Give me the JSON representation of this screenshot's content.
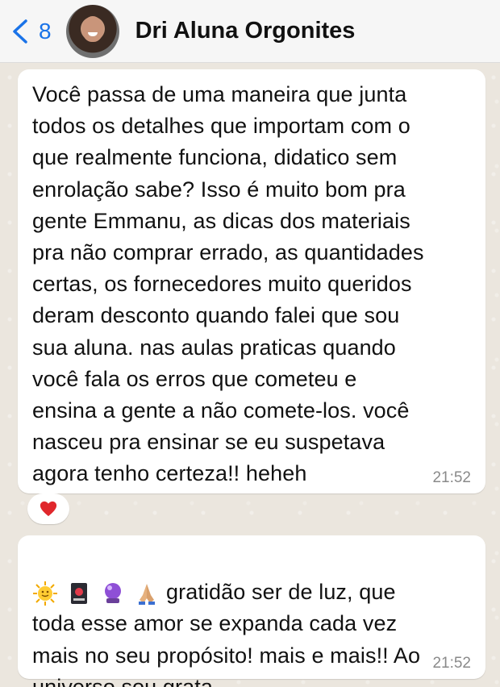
{
  "header": {
    "back_count": "8",
    "contact_name": "Dri Aluna Orgonites"
  },
  "messages": [
    {
      "text": "Você passa de uma maneira que junta\ntodos os detalhes que importam com o\nque realmente funciona, didatico sem\nenrolação sabe? Isso é muito bom pra\ngente Emmanu, as dicas dos materiais\npra não comprar errado, as quantidades\ncertas, os fornecedores muito queridos\nderam desconto quando falei que sou\nsua aluna. nas aulas praticas quando\nvocê fala os erros que cometeu e\nensina a gente a não comete-los. você\nnasceu pra ensinar se eu suspetava\nagora tenho certeza!! heheh",
      "time": "21:52",
      "reaction": "heart"
    },
    {
      "emojis": [
        "sun-face-icon",
        "flower-playing-card-icon",
        "crystal-ball-icon",
        "folded-hands-icon"
      ],
      "text": "gratidão ser de luz, que\ntoda esse amor se expanda cada vez\nmais no seu propósito! mais e mais!! Ao\nuniverso sou grata",
      "time": "21:52"
    }
  ],
  "colors": {
    "accent": "#1a73e8",
    "bubble": "#ffffff",
    "chat_background": "#ebe6de",
    "timestamp": "#8a8a8a",
    "heart": "#e0272c"
  }
}
